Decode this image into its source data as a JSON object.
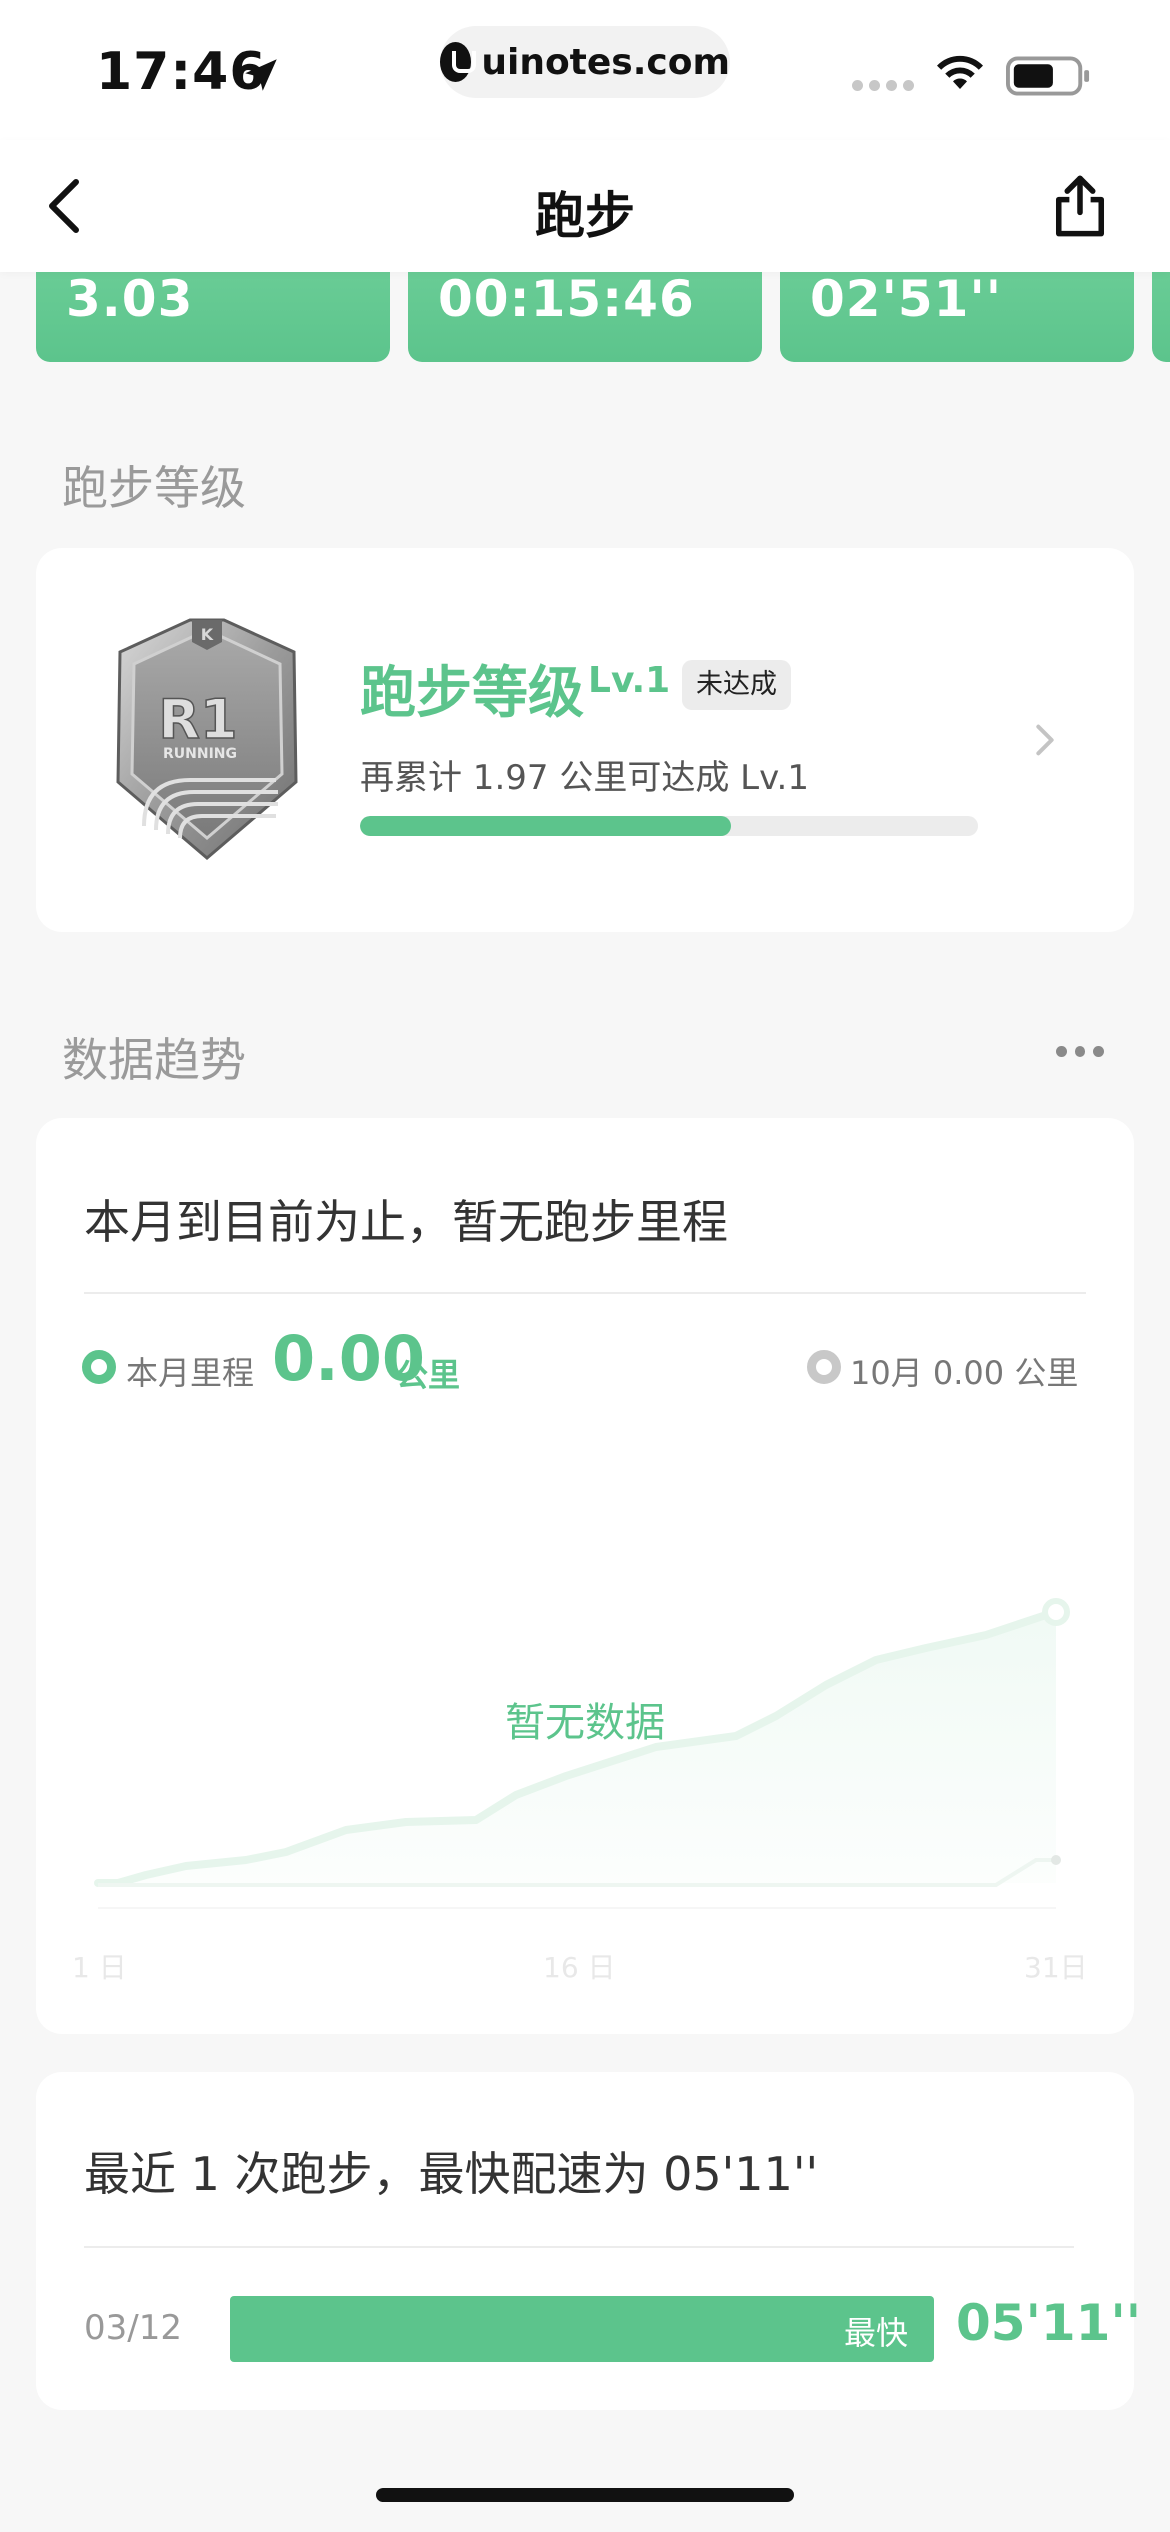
{
  "status_bar": {
    "time": "17:46",
    "url": "uinotes.com",
    "icons": [
      "location-arrow-icon",
      "site-logo-icon",
      "signal-icon",
      "wifi-icon",
      "battery-icon"
    ]
  },
  "nav": {
    "title": "跑步",
    "icons": [
      "back-chevron-icon",
      "share-icon"
    ]
  },
  "top_stats": [
    "3.03",
    "00:15:46",
    "02'51''"
  ],
  "level_section": {
    "title": "跑步等级",
    "card": {
      "badge_code": "R1",
      "badge_label": "RUNNING",
      "level_title": "跑步等级",
      "level": "Lv.1",
      "tag": "未达成",
      "description": "再累计 1.97 公里可达成 Lv.1",
      "progress_fraction": 0.6
    }
  },
  "trend_section": {
    "title": "数据趋势",
    "card": {
      "headline": "本月到目前为止，暂无跑步里程",
      "legend_current_label": "本月里程",
      "legend_current_value": "0.00",
      "legend_current_unit": "公里",
      "legend_compare": "10月  0.00 公里",
      "no_data": "暂无数据",
      "x_ticks": [
        "1 日",
        "16 日",
        "31日"
      ]
    }
  },
  "pace_section": {
    "headline": "最近 1 次跑步，最快配速为 05'11''",
    "rows": [
      {
        "date": "03/12",
        "bar_label": "最快",
        "value": "05'11''",
        "fraction": 1.0
      }
    ]
  },
  "colors": {
    "accent": "#5cc48c",
    "background": "#f7f7f7",
    "card": "#ffffff"
  }
}
